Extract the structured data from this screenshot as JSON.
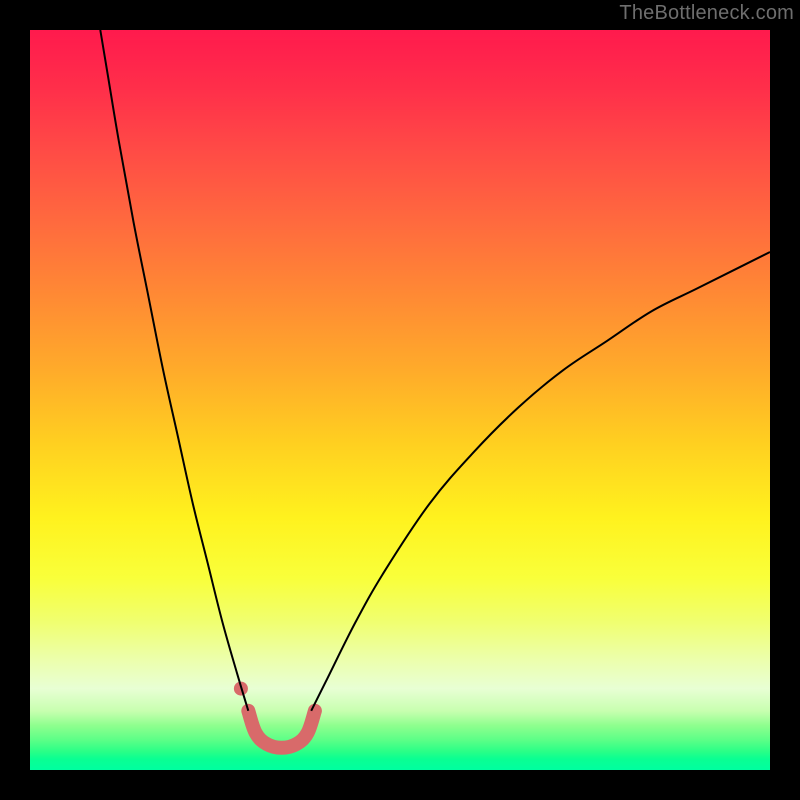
{
  "watermark": {
    "text": "TheBottleneck.com"
  },
  "chart_data": {
    "type": "line",
    "title": "",
    "xlabel": "",
    "ylabel": "",
    "xlim": [
      0,
      100
    ],
    "ylim": [
      0,
      100
    ],
    "grid": false,
    "legend": false,
    "background_gradient": {
      "top": "#ff1a4d",
      "mid": "#fff21e",
      "bottom": "#00ffa0"
    },
    "series": [
      {
        "name": "left-branch",
        "stroke": "#000000",
        "stroke_width": 2,
        "points": [
          {
            "x": 9.5,
            "y": 100
          },
          {
            "x": 10.5,
            "y": 94
          },
          {
            "x": 12,
            "y": 85
          },
          {
            "x": 14,
            "y": 74
          },
          {
            "x": 16,
            "y": 64
          },
          {
            "x": 18,
            "y": 54
          },
          {
            "x": 20,
            "y": 45
          },
          {
            "x": 22,
            "y": 36
          },
          {
            "x": 24,
            "y": 28
          },
          {
            "x": 26,
            "y": 20
          },
          {
            "x": 28,
            "y": 13
          },
          {
            "x": 29.5,
            "y": 8
          }
        ]
      },
      {
        "name": "right-branch",
        "stroke": "#000000",
        "stroke_width": 2,
        "points": [
          {
            "x": 38,
            "y": 8
          },
          {
            "x": 40,
            "y": 12
          },
          {
            "x": 44,
            "y": 20
          },
          {
            "x": 48,
            "y": 27
          },
          {
            "x": 54,
            "y": 36
          },
          {
            "x": 60,
            "y": 43
          },
          {
            "x": 66,
            "y": 49
          },
          {
            "x": 72,
            "y": 54
          },
          {
            "x": 78,
            "y": 58
          },
          {
            "x": 84,
            "y": 62
          },
          {
            "x": 90,
            "y": 65
          },
          {
            "x": 96,
            "y": 68
          },
          {
            "x": 100,
            "y": 70
          }
        ]
      },
      {
        "name": "valley-highlight",
        "stroke": "#d86a6a",
        "stroke_width": 14,
        "linecap": "round",
        "points": [
          {
            "x": 29.5,
            "y": 8
          },
          {
            "x": 30.5,
            "y": 5
          },
          {
            "x": 32,
            "y": 3.5
          },
          {
            "x": 34,
            "y": 3
          },
          {
            "x": 36,
            "y": 3.5
          },
          {
            "x": 37.5,
            "y": 5
          },
          {
            "x": 38.5,
            "y": 8
          }
        ]
      },
      {
        "name": "valley-marker-dot",
        "type": "point",
        "fill": "#d86a6a",
        "radius": 7,
        "points": [
          {
            "x": 28.5,
            "y": 11
          }
        ]
      }
    ]
  }
}
